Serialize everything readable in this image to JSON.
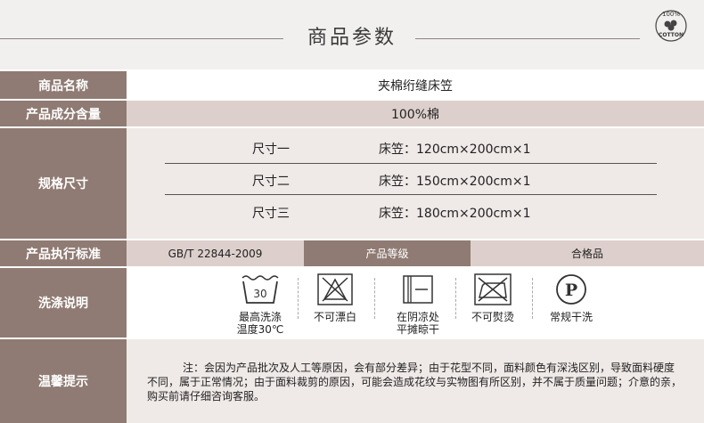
{
  "header": {
    "title": "商品参数",
    "logo_top": "100%",
    "logo_bottom": "COTTON"
  },
  "rows": {
    "name": {
      "label": "商品名称",
      "value": "夹棉绗缝床笠"
    },
    "composition": {
      "label": "产品成分含量",
      "value": "100%棉"
    },
    "size": {
      "label": "规格尺寸",
      "items": [
        {
          "name": "尺寸一",
          "spec": "床笠：120cm×200cm×1"
        },
        {
          "name": "尺寸二",
          "spec": "床笠：150cm×200cm×1"
        },
        {
          "name": "尺寸三",
          "spec": "床笠：180cm×200cm×1"
        }
      ]
    },
    "standard": {
      "label": "产品执行标准",
      "value": "GB/T 22844-2009",
      "grade_label": "产品等级",
      "grade_value": "合格品"
    },
    "wash": {
      "label": "洗涤说明",
      "items": [
        {
          "icon": "wash-30-icon",
          "number": "30",
          "line1": "最高洗涤",
          "line2": "温度30℃"
        },
        {
          "icon": "no-bleach-icon",
          "line1": "不可漂白",
          "line2": ""
        },
        {
          "icon": "shade-dry-icon",
          "line1": "在阴凉处",
          "line2": "平摊晾干"
        },
        {
          "icon": "no-iron-icon",
          "line1": "不可熨烫",
          "line2": ""
        },
        {
          "icon": "dry-clean-p-icon",
          "letter": "P",
          "line1": "常规干洗",
          "line2": ""
        }
      ]
    },
    "tips": {
      "label": "温馨提示",
      "text": "注：会因为产品批次及人工等原因，会有部分差异；由于花型不同，面料颜色有深浅区别，导致面料硬度不同，属于正常情况；由于面料裁剪的原因，可能会造成花纹与实物图有所区别，并不属于质量问题；介意的亲，购买前请仔细咨询客服。"
    }
  },
  "colors": {
    "label_bg": "#8f7b73",
    "row_light": "#efe9e7",
    "row_pink": "#ddd0cc",
    "header_bg": "#f2f0ef"
  }
}
